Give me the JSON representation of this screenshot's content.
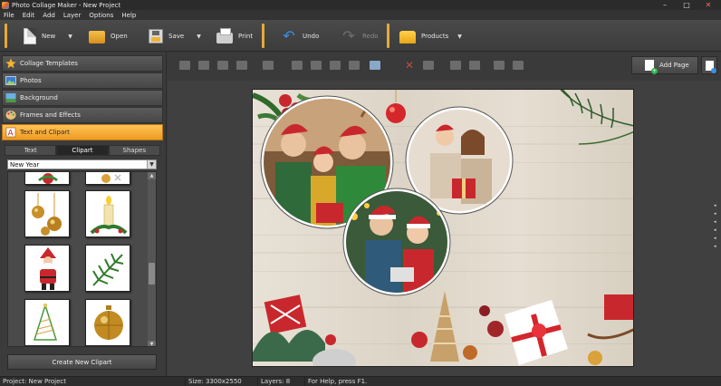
{
  "window": {
    "title": "Photo Collage Maker - New Project",
    "controls": {
      "minimize": "–",
      "maximize": "□",
      "close": "✕"
    }
  },
  "menu": [
    "File",
    "Edit",
    "Add",
    "Layer",
    "Options",
    "Help"
  ],
  "toolbar": {
    "new": {
      "label": "New",
      "icon": "new-document-icon"
    },
    "open": {
      "label": "Open",
      "icon": "folder-icon"
    },
    "save": {
      "label": "Save",
      "icon": "floppy-disk-icon"
    },
    "print": {
      "label": "Print",
      "icon": "printer-icon"
    },
    "undo": {
      "label": "Undo",
      "icon": "undo-arrow-icon"
    },
    "redo": {
      "label": "Redo",
      "icon": "redo-arrow-icon"
    },
    "products": {
      "label": "Products",
      "icon": "gift-icon"
    },
    "caret": "▼"
  },
  "sidebar": {
    "sections": [
      {
        "label": "Collage Templates",
        "icon": "star-icon"
      },
      {
        "label": "Photos",
        "icon": "photo-icon"
      },
      {
        "label": "Background",
        "icon": "background-icon"
      },
      {
        "label": "Frames and Effects",
        "icon": "palette-icon"
      },
      {
        "label": "Text and Clipart",
        "icon": "text-clipart-icon",
        "active": true
      }
    ],
    "subtabs": [
      {
        "label": "Text"
      },
      {
        "label": "Clipart",
        "active": true
      },
      {
        "label": "Shapes"
      }
    ],
    "category": {
      "value": "New Year",
      "arrow": "▼"
    },
    "clipart_items": [
      "christmas-ornament-partial",
      "snowflake-partial",
      "gold-ball-ornaments",
      "golden-candle",
      "santa-claus",
      "fir-branch",
      "christmas-tree",
      "gold-ornament-ball"
    ],
    "scroll": {
      "up": "▲",
      "down": "▼"
    },
    "create_button": "Create New Clipart"
  },
  "actions": {
    "add_page": "Add Page",
    "page_settings_icon": "page-settings-icon"
  },
  "canvas": {
    "background": "rustic-white-wood-christmas",
    "photos": [
      "family-selfie-santa-hats",
      "mother-daughter-christmas-gift",
      "mother-daughter-santa-hats"
    ],
    "handles": [
      "◂",
      "◂",
      "◂",
      "◂",
      "◂",
      "◂"
    ]
  },
  "statusbar": {
    "project": "Project: New Project",
    "size": "Size: 3300x2550",
    "layers": "Layers: 8",
    "help": "For Help, press F1."
  },
  "colors": {
    "accent": "#EE9A1F",
    "panel": "#3B3B3B",
    "workspace": "#404040"
  }
}
